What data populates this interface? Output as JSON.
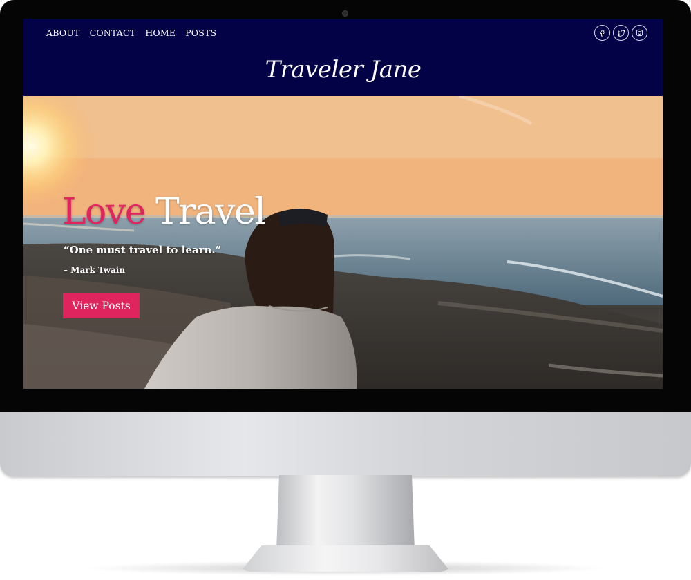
{
  "site": {
    "nav": [
      "ABOUT",
      "CONTACT",
      "HOME",
      "POSTS"
    ],
    "title": "Traveler Jane",
    "social": [
      "facebook-icon",
      "twitter-icon",
      "instagram-icon"
    ]
  },
  "hero": {
    "heading_accent": "Love",
    "heading_rest": "Travel",
    "quote": "“One must travel to learn.”",
    "author": "– Mark Twain",
    "button": "View Posts"
  },
  "colors": {
    "header_bg": "#040246",
    "accent": "#e0245e"
  }
}
